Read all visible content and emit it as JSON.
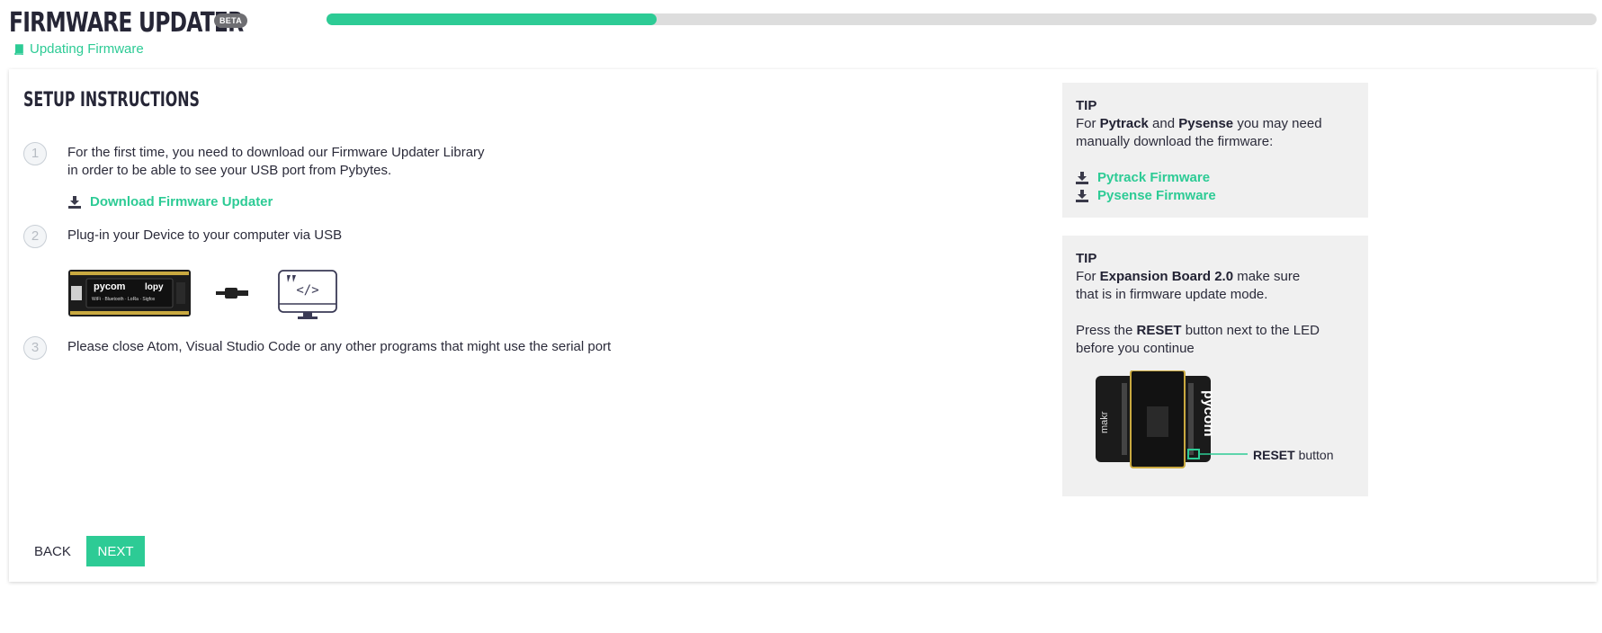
{
  "header": {
    "title": "FIRMWARE UPDATER",
    "badge": "BETA",
    "subtitle": "Updating Firmware",
    "progress_percent": 26
  },
  "setup": {
    "title": "SETUP INSTRUCTIONS",
    "steps": [
      {
        "number": "1",
        "line1": "For the first time, you need to download our Firmware Updater Library",
        "line2": "in order to be able to see your USB port from Pybytes.",
        "link_label": "Download Firmware Updater"
      },
      {
        "number": "2",
        "text": "Plug-in your Device to your computer via USB"
      },
      {
        "number": "3",
        "text": "Please close Atom, Visual Studio Code or any other programs that might use the serial port"
      }
    ]
  },
  "device_illustration": {
    "brand": "pycom",
    "model": "lopy",
    "caption": "WiFi · Bluetooth · LoRa · Sigfox"
  },
  "tips": [
    {
      "heading": "TIP",
      "prefix": "For ",
      "bold1": "Pytrack",
      "mid": " and ",
      "bold2": "Pysense",
      "suffix": " you may need",
      "line2": "manually download the firmware:",
      "links": [
        "Pytrack Firmware",
        "Pysense Firmware"
      ]
    },
    {
      "heading": "TIP",
      "prefix": "For ",
      "bold": "Expansion Board 2.0",
      "suffix": " make sure",
      "line2": "that is in firmware update mode.",
      "press_prefix": "Press the ",
      "press_bold": "RESET",
      "press_suffix": " button next to the LED",
      "press_line2": "before you continue",
      "board_brand": "pycom",
      "board_label": "makr",
      "callout_bold": "RESET",
      "callout_text": " button"
    }
  ],
  "actions": {
    "back_label": "BACK",
    "next_label": "NEXT"
  },
  "colors": {
    "accent": "#2dcb95",
    "text": "#2b2b3a",
    "tip_bg": "#f0f0f0"
  }
}
